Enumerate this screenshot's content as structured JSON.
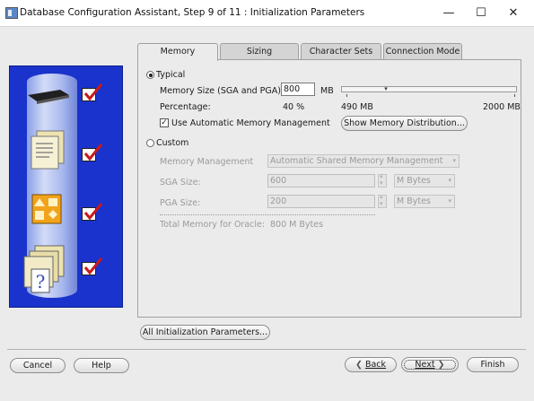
{
  "window": {
    "title": "Database Configuration Assistant, Step 9 of 11 : Initialization Parameters",
    "controls": {
      "minimize": "—",
      "maximize": "☐",
      "close": "✕"
    }
  },
  "tabs": [
    {
      "label": "Memory",
      "active": true
    },
    {
      "label": "Sizing",
      "active": false
    },
    {
      "label": "Character Sets",
      "active": false
    },
    {
      "label": "Connection Mode",
      "active": false
    }
  ],
  "memory": {
    "typical_label": "Typical",
    "typical_selected": true,
    "memory_size_label": "Memory Size (SGA and PGA):",
    "memory_size_value": "800",
    "memory_size_unit": "MB",
    "percentage_label": "Percentage:",
    "percentage_value": "40 %",
    "current_mb": "490 MB",
    "max_mb": "2000 MB",
    "slider_fraction": 0.24,
    "amm_checkbox_label": "Use Automatic Memory Management",
    "amm_checked": true,
    "show_distribution_button": "Show Memory Distribution...",
    "custom_label": "Custom",
    "custom_selected": false,
    "memory_management_label": "Memory Management",
    "memory_management_value": "Automatic Shared Memory Management",
    "sga_size_label": "SGA Size:",
    "sga_size_value": "600",
    "sga_unit": "M Bytes",
    "pga_size_label": "PGA Size:",
    "pga_size_value": "200",
    "pga_unit": "M Bytes",
    "total_memory_label": "Total Memory for Oracle:",
    "total_memory_value": "800 M Bytes"
  },
  "buttons": {
    "all_init_params": "All Initialization Parameters...",
    "cancel": "Cancel",
    "help": "Help",
    "back": "Back",
    "next": "Next",
    "finish": "Finish"
  },
  "colors": {
    "side_image_background": "#1a33cc",
    "check_mark": "#c81a1a"
  }
}
